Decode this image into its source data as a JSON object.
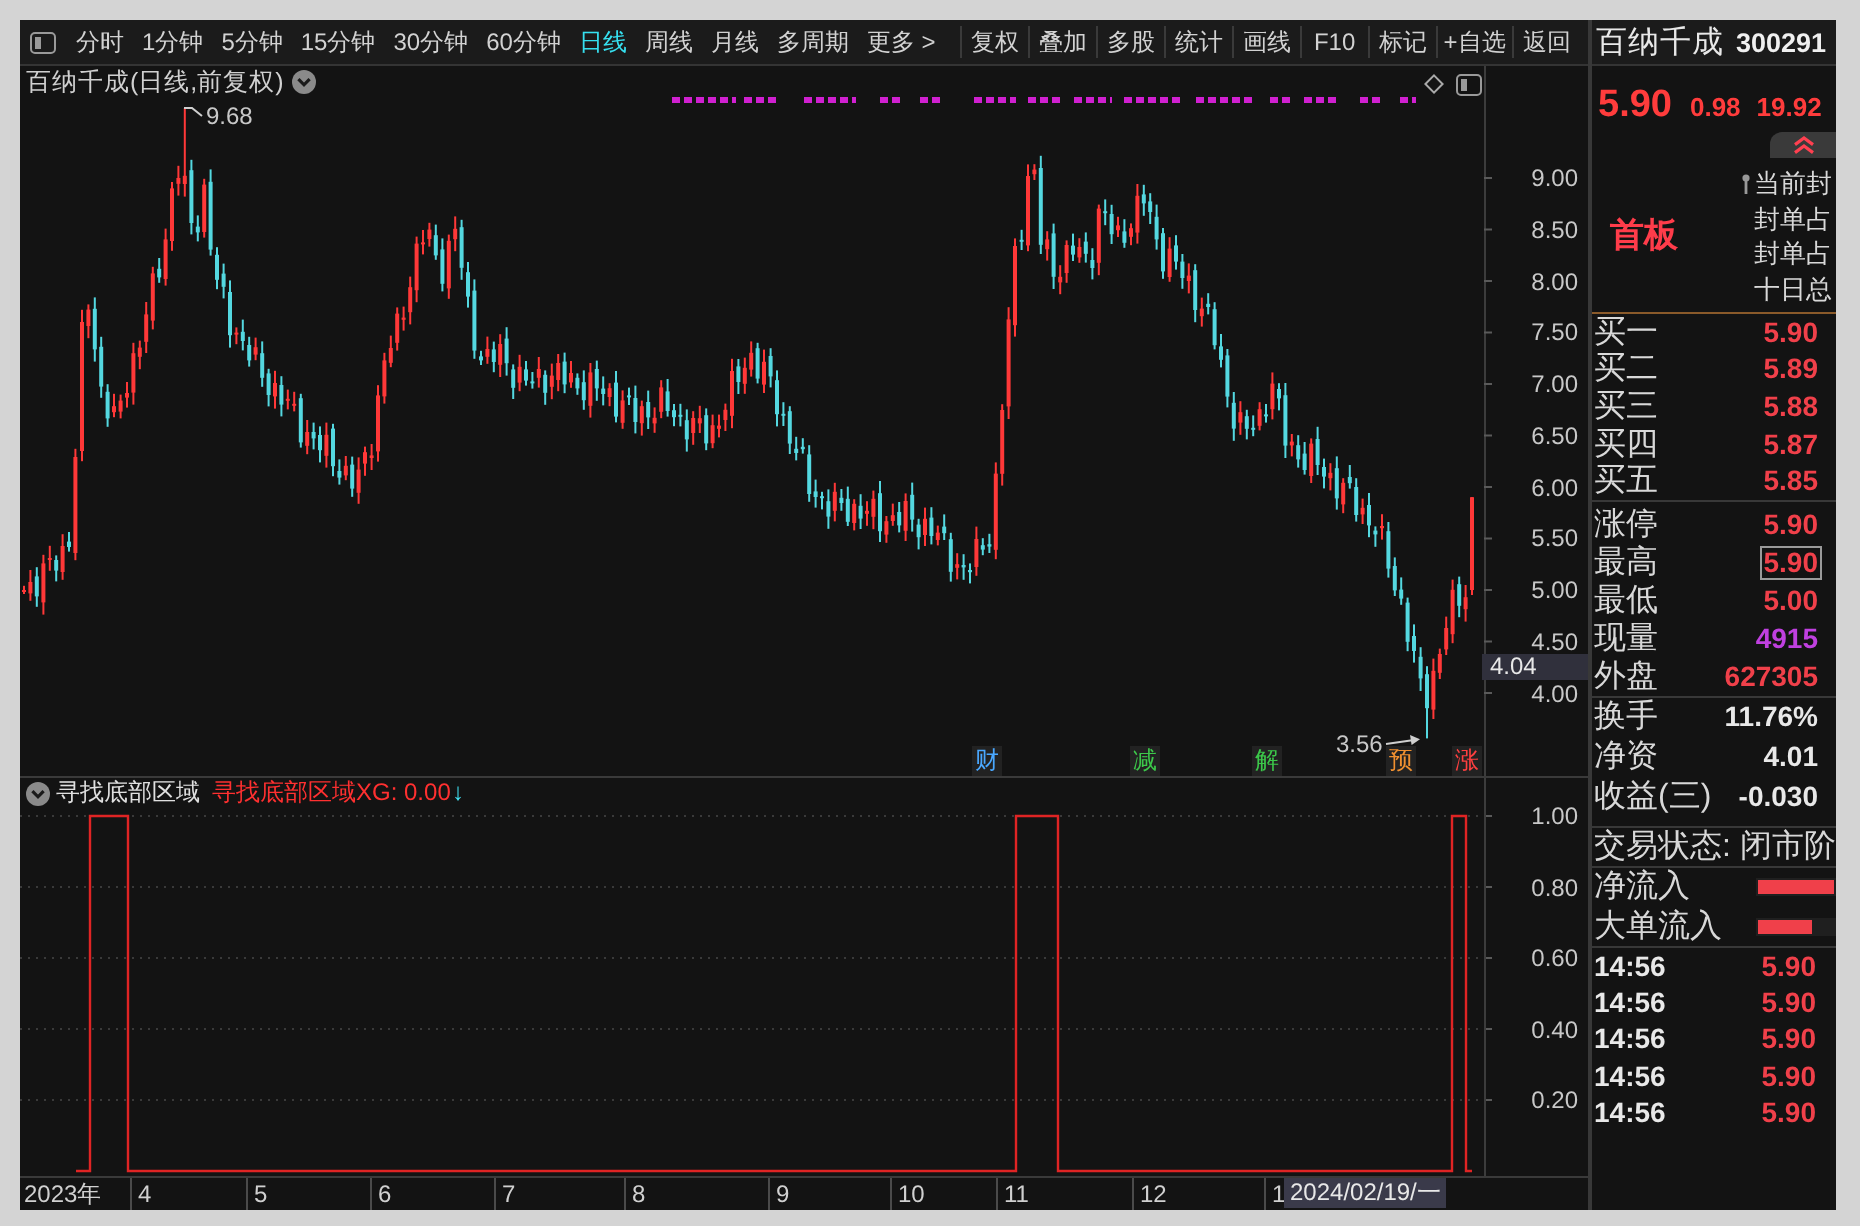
{
  "toolbar": {
    "periods": [
      {
        "label": "分时",
        "selected": false
      },
      {
        "label": "1分钟",
        "selected": false
      },
      {
        "label": "5分钟",
        "selected": false
      },
      {
        "label": "15分钟",
        "selected": false
      },
      {
        "label": "30分钟",
        "selected": false
      },
      {
        "label": "60分钟",
        "selected": false
      },
      {
        "label": "日线",
        "selected": true
      },
      {
        "label": "周线",
        "selected": false
      },
      {
        "label": "月线",
        "selected": false
      },
      {
        "label": "多周期",
        "selected": false
      }
    ],
    "more": "更多 >",
    "actions": [
      "复权",
      "叠加",
      "多股",
      "统计",
      "画线",
      "F10",
      "标记",
      "+自选",
      "返回"
    ]
  },
  "price_chart": {
    "title": "百纳千成(日线,前复权)",
    "price_axis": [
      "9.00",
      "8.50",
      "8.00",
      "7.50",
      "7.00",
      "6.50",
      "6.00",
      "5.50",
      "5.00",
      "4.50",
      "4.00"
    ],
    "cursor_price": "4.04",
    "high_label": "9.68",
    "low_label": "3.56",
    "events": [
      {
        "label": "财",
        "color": "#4aa8ff"
      },
      {
        "label": "减",
        "color": "#3cc84a"
      },
      {
        "label": "解",
        "color": "#3cc84a"
      },
      {
        "label": "预",
        "color": "#f09030"
      },
      {
        "label": "涨",
        "color": "#ff4040"
      }
    ]
  },
  "indicator": {
    "name": "寻找底部区域",
    "reading": "寻找底部区域XG: 0.00",
    "arrow": "↓",
    "axis": [
      "1.00",
      "0.80",
      "0.60",
      "0.40",
      "0.20"
    ]
  },
  "date_axis": {
    "labels": [
      "2023年",
      "4",
      "5",
      "6",
      "7",
      "8",
      "9",
      "10",
      "11",
      "12",
      "1"
    ],
    "cursor_date": "2024/02/19/一"
  },
  "quote": {
    "name": "百纳千成",
    "code": "300291",
    "price": "5.90",
    "change": "0.98",
    "change_pct": "19.92",
    "board": "首板",
    "seal_info": [
      "当前封",
      "封单占",
      "封单占",
      "十日总"
    ],
    "bids": [
      {
        "label": "买一",
        "price": "5.90"
      },
      {
        "label": "买二",
        "price": "5.89"
      },
      {
        "label": "买三",
        "price": "5.88"
      },
      {
        "label": "买四",
        "price": "5.87"
      },
      {
        "label": "买五",
        "price": "5.85"
      }
    ],
    "stats": [
      {
        "label": "涨停",
        "value": "5.90",
        "color": "#f0404a",
        "highlighted": false
      },
      {
        "label": "最高",
        "value": "5.90",
        "color": "#f0404a",
        "highlighted": true
      },
      {
        "label": "最低",
        "value": "5.00",
        "color": "#f0404a",
        "highlighted": false
      },
      {
        "label": "现量",
        "value": "4915",
        "color": "#c040e0",
        "highlighted": false
      },
      {
        "label": "外盘",
        "value": "627305",
        "color": "#f0404a",
        "highlighted": false
      }
    ],
    "ratios": [
      {
        "label": "换手",
        "value": "11.76%"
      },
      {
        "label": "净资",
        "value": "4.01"
      },
      {
        "label": "收益(三)",
        "value": "-0.030"
      }
    ],
    "status": "交易状态: 闭市阶",
    "flows": [
      {
        "label": "净流入",
        "level": 1
      },
      {
        "label": "大单流入",
        "level": 0.7
      }
    ],
    "ticks": [
      {
        "time": "14:56",
        "price": "5.90"
      },
      {
        "time": "14:56",
        "price": "5.90"
      },
      {
        "time": "14:56",
        "price": "5.90"
      },
      {
        "time": "14:56",
        "price": "5.90"
      },
      {
        "time": "14:56",
        "price": "5.90"
      }
    ]
  }
}
